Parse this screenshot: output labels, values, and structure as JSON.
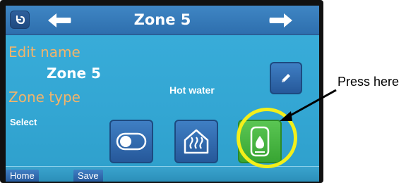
{
  "header": {
    "title": "Zone 5",
    "back_icon": "back-icon",
    "prev_icon": "arrow-left-icon",
    "next_icon": "arrow-right-icon"
  },
  "form": {
    "edit_name_label": "Edit name",
    "zone_name_value": "Zone 5",
    "zone_type_label": "Zone type",
    "select_label": "Select",
    "current_type": "Hot water",
    "edit_icon": "pencil-icon"
  },
  "type_options": [
    {
      "icon": "toggle-switch-icon",
      "selected": false
    },
    {
      "icon": "underfloor-heating-icon",
      "selected": false
    },
    {
      "icon": "hot-water-cylinder-icon",
      "selected": true
    }
  ],
  "footer": {
    "home_label": "Home",
    "save_label": "Save"
  },
  "annotation": {
    "text": "Press here"
  },
  "colors": {
    "screen_bg": "#3aaedb",
    "header_bg": "#2e6fae",
    "label_orange": "#f2b46a",
    "button_blue": "#26589a",
    "selected_green": "#38a533",
    "highlight_ring": "#f3ef1a"
  }
}
